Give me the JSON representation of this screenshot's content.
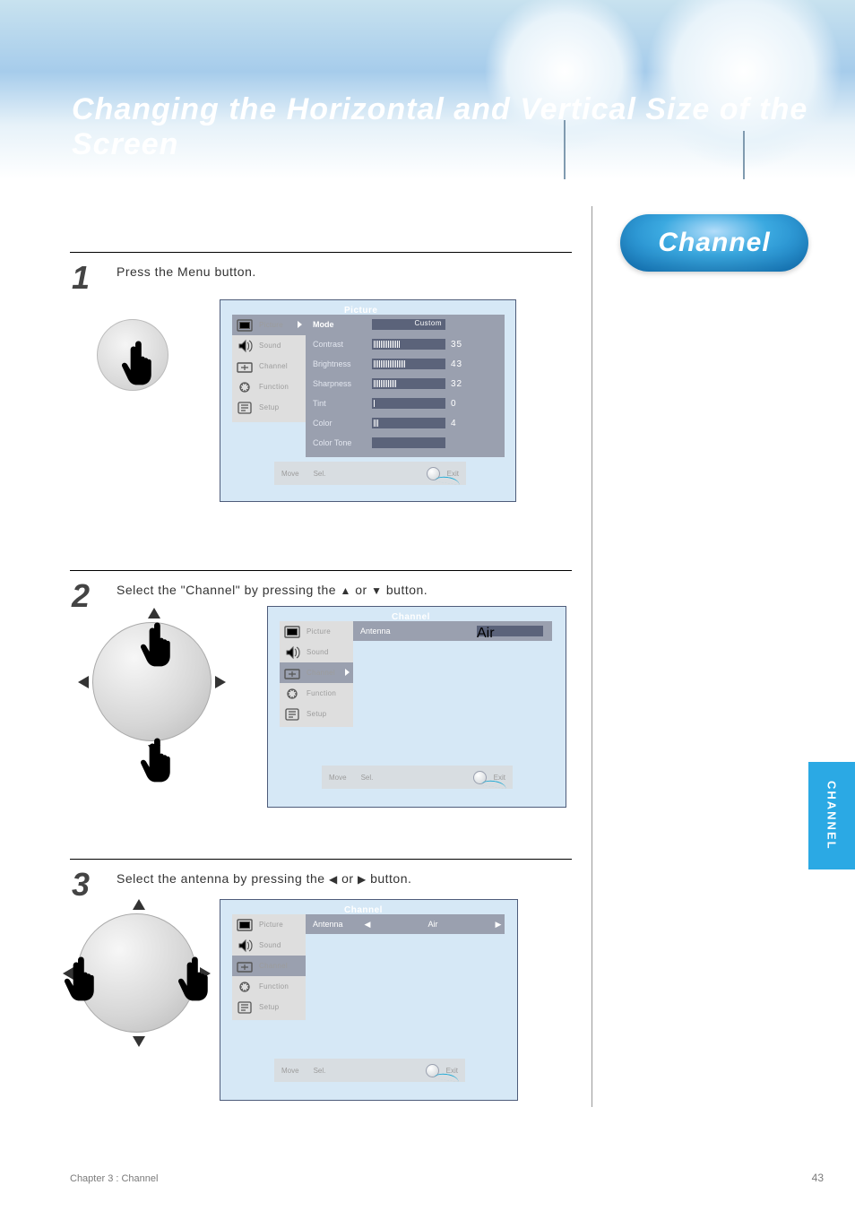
{
  "page_title": "Changing the Horizontal and Vertical Size of the Screen",
  "page_badge": "Channel",
  "side_tab": "CHANNEL",
  "chapter_line": "Chapter 3 : Channel",
  "page_number": "43",
  "steps": {
    "s1": {
      "num": "1",
      "text": "Press the Menu button."
    },
    "s2": {
      "num": "2",
      "text_pre": "Select the \"Channel\" by pressing the ",
      "tri1": "▲",
      "text_mid": " or ",
      "tri2": "▼",
      "text_post": " button."
    },
    "s3": {
      "num": "3",
      "text_pre": "Select the antenna by pressing the ",
      "tri1": "◀",
      "text_mid": " or ",
      "tri2": "▶",
      "text_post": " button."
    }
  },
  "osd1": {
    "title": "Picture",
    "items": [
      "Picture",
      "Sound",
      "Channel",
      "Function",
      "Setup"
    ],
    "rows": [
      {
        "label": "Mode",
        "valueText": "Custom"
      },
      {
        "label": "Contrast",
        "fill": "35",
        "num": "35"
      },
      {
        "label": "Brightness",
        "fill": "43",
        "num": "43"
      },
      {
        "label": "Sharpness",
        "fill": "32",
        "num": "32"
      },
      {
        "label": "Tint",
        "fill": "0",
        "num": "0"
      },
      {
        "label": "Color",
        "fill": "4",
        "num": "4"
      },
      {
        "label": "Color Tone",
        "valueText": ""
      }
    ],
    "nav": {
      "move": "Move",
      "sel": "Sel.",
      "exit": "Exit"
    }
  },
  "osd2": {
    "title": "Channel",
    "items": [
      "Picture",
      "Sound",
      "Channel",
      "Function",
      "Setup"
    ],
    "header": {
      "label": "Antenna",
      "value": "Air"
    },
    "nav": {
      "move": "Move",
      "sel": "Sel.",
      "exit": "Exit"
    }
  },
  "osd3": {
    "title": "Channel",
    "items": [
      "Picture",
      "Sound",
      "Channel",
      "Function",
      "Setup"
    ],
    "source": {
      "label": "Antenna",
      "value": "Air"
    },
    "nav": {
      "move": "Move",
      "sel": "Sel.",
      "exit": "Exit"
    }
  }
}
